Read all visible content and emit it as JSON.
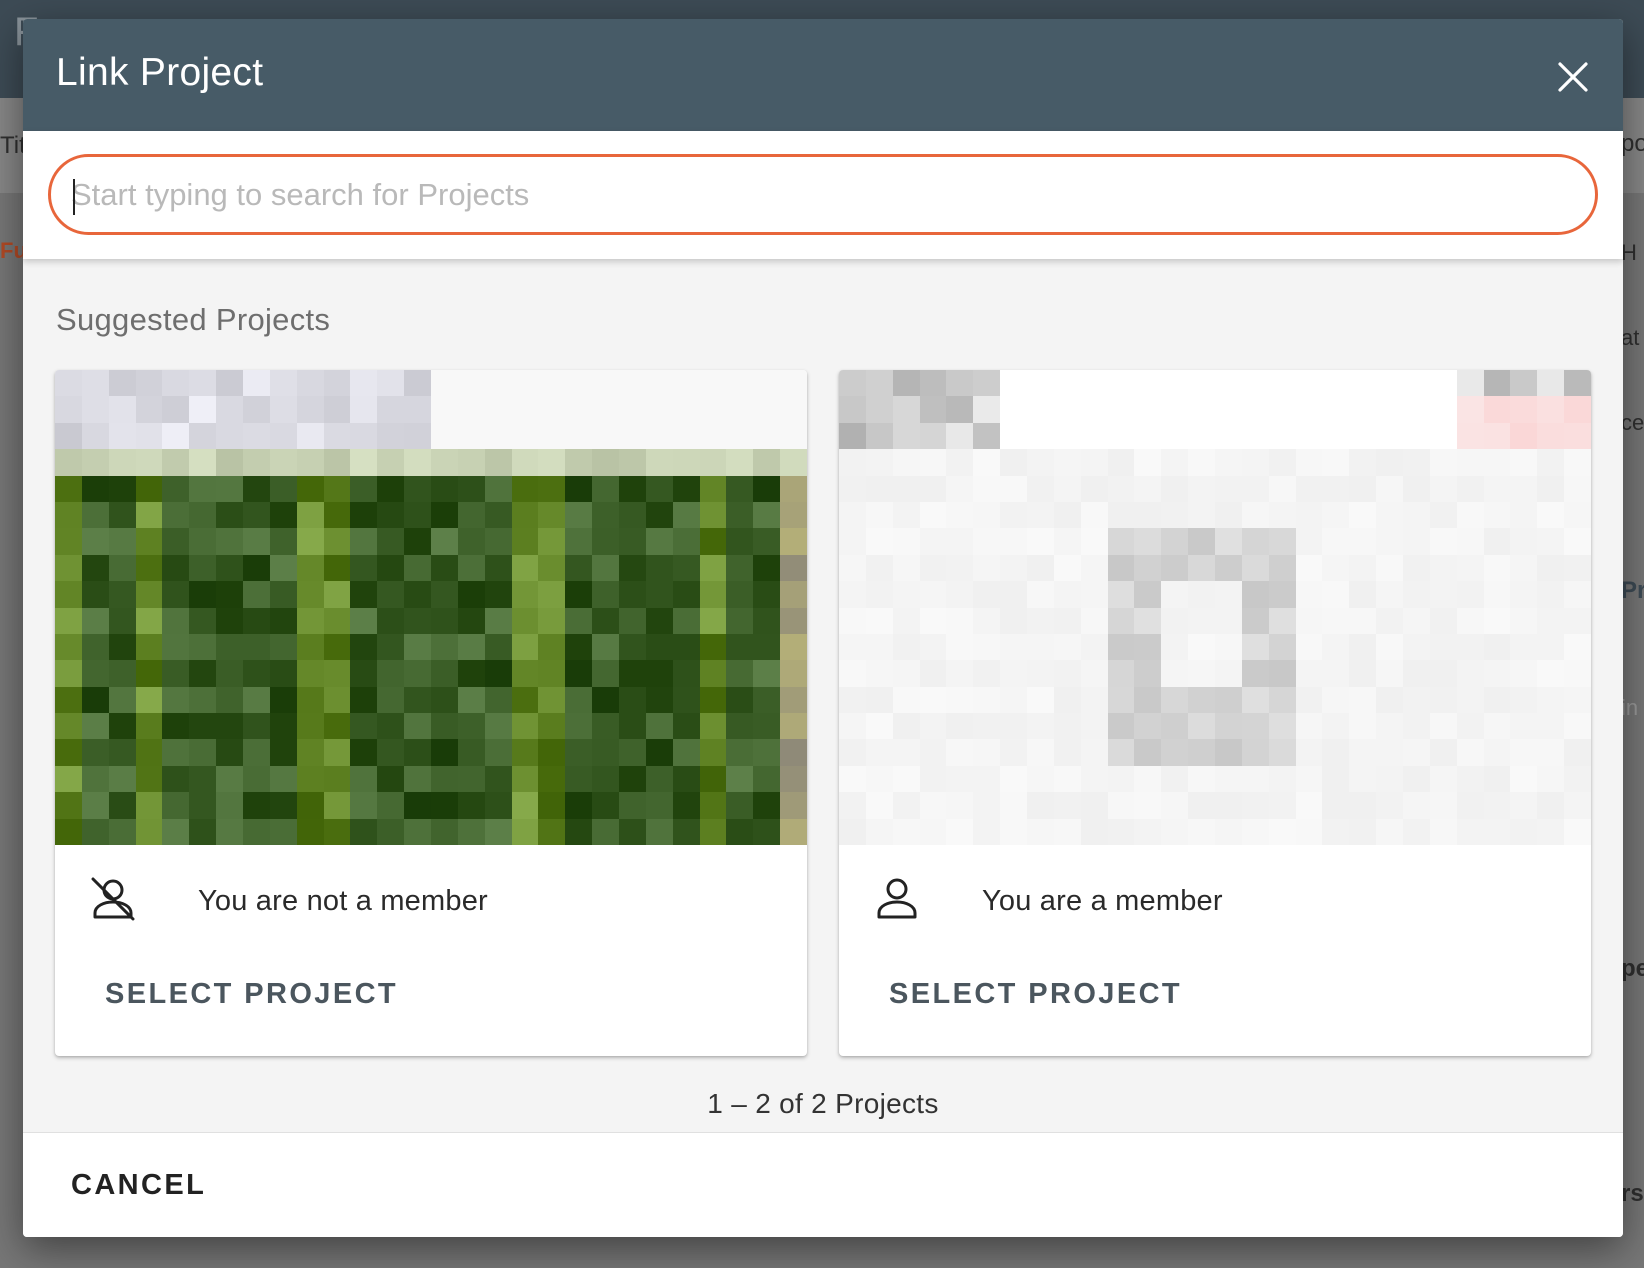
{
  "background": {
    "header_letter": "F",
    "strip_left_text": "Tit",
    "left_link": "Fu",
    "right_fragments": [
      "po",
      "H",
      "at",
      "ce,",
      "Pr",
      "in",
      "pe",
      "rs"
    ]
  },
  "dialog": {
    "title": "Link Project",
    "close_icon": "close-icon",
    "search": {
      "placeholder": "Start typing to search for Projects",
      "value": ""
    },
    "section_title": "Suggested Projects",
    "cards": [
      {
        "thumbnail": "blurred-green-foliage-image",
        "member_icon": "person-off-icon",
        "member_status": "You are not a member",
        "select_label": "SELECT PROJECT"
      },
      {
        "thumbnail": "blurred-placeholder-image",
        "member_icon": "person-icon",
        "member_status": "You are a member",
        "select_label": "SELECT PROJECT"
      }
    ],
    "pagination": "1 – 2 of 2 Projects",
    "cancel_label": "CANCEL"
  },
  "colors": {
    "header": "#475b67",
    "search_border": "#e8663b",
    "button_text": "#4b565e",
    "scrim": "#777777"
  }
}
